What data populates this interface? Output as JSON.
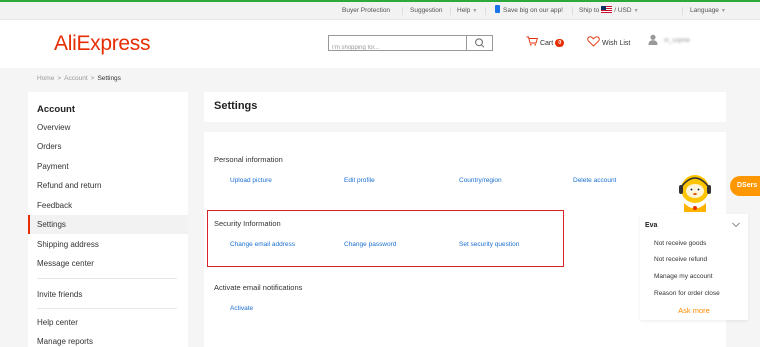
{
  "topbar": {
    "buyer_protection": "Buyer Protection",
    "suggestion": "Suggestion",
    "help": "Help",
    "app_promo": "Save big on our app!",
    "ship_to": "Ship to",
    "currency": "/ USD",
    "language": "Language"
  },
  "header": {
    "logo": "AliExpress",
    "search_placeholder": "I'm shopping for...",
    "cart_label": "Cart",
    "cart_count": "0",
    "wishlist_label": "Wish List",
    "username": "m_sophie"
  },
  "breadcrumb": {
    "home": "Home",
    "account": "Account",
    "current": "Settings",
    "separator": ">"
  },
  "sidebar": {
    "title": "Account",
    "items": [
      "Overview",
      "Orders",
      "Payment",
      "Refund and return",
      "Feedback",
      "Settings",
      "Shipping address",
      "Message center",
      "Invite friends",
      "Help center",
      "Manage reports"
    ],
    "active": "Settings"
  },
  "main": {
    "title": "Settings",
    "personal": {
      "title": "Personal information",
      "links": [
        "Upload picture",
        "Edit profile",
        "Country/region",
        "Delete account"
      ]
    },
    "security": {
      "title": "Security Information",
      "links": [
        "Change email address",
        "Change password",
        "Set security question"
      ]
    },
    "notifications": {
      "title": "Activate email notifications",
      "links": [
        "Activate"
      ]
    }
  },
  "widgets": {
    "dsers_label": "DSers",
    "chat": {
      "agent_name": "Eva",
      "options": [
        "Not receive goods",
        "Not receive refund",
        "Manage my account",
        "Reason for order close"
      ],
      "ask_more": "Ask more"
    }
  },
  "colors": {
    "brand": "#e62e04",
    "link": "#1a6fd1",
    "highlight_box": "#d8232a",
    "dsers": "#ff9800",
    "ask_more": "#ff8a00"
  }
}
